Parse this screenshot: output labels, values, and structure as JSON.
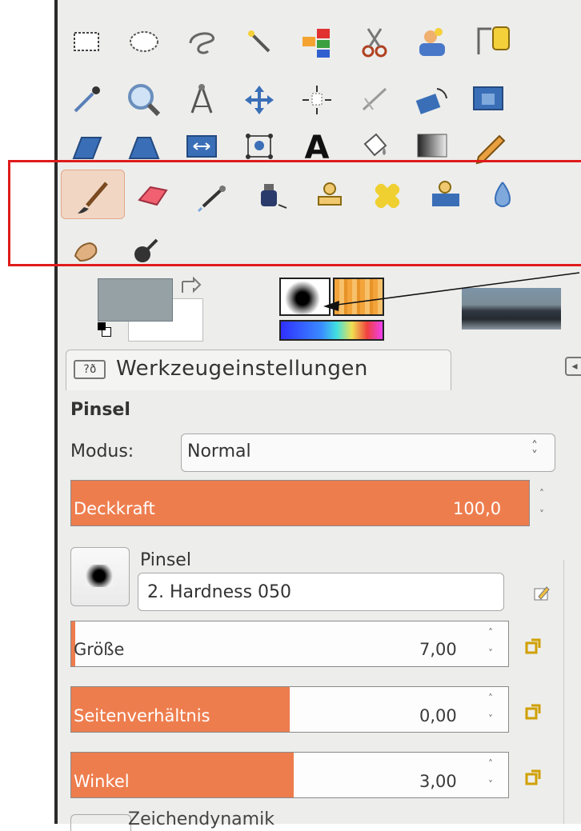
{
  "toolbox": {
    "icons": [
      "rect-select-icon",
      "ellipse-select-icon",
      "free-select-icon",
      "fuzzy-select-icon",
      "color-select-icon",
      "scissors-select-icon",
      "foreground-select-icon",
      "paths-tool-icon",
      "color-picker-icon",
      "zoom-icon",
      "measure-icon",
      "move-icon",
      "align-icon",
      "crop-icon",
      "rotate-icon",
      "scale-icon",
      "shear-icon",
      "perspective-icon",
      "flip-icon",
      "cage-transform-icon",
      "text-tool-icon",
      "bucket-fill-icon",
      "blend-icon",
      "pencil-icon",
      "paintbrush-icon",
      "eraser-icon",
      "airbrush-icon",
      "ink-icon",
      "clone-icon",
      "heal-icon",
      "perspective-clone-icon",
      "blur-sharpen-icon",
      "smudge-icon",
      "dodge-burn-icon"
    ],
    "active_tool": "paintbrush-icon",
    "highlight_color": "#e01b1b"
  },
  "colors": {
    "foreground": "#96a1a6",
    "background": "#ffffff",
    "accent": "#ee7d4e"
  },
  "tool_options": {
    "tab_icon_text": "?ð",
    "tab_label": "Werkzeugeinstellungen",
    "section_title": "Pinsel",
    "modus_label": "Modus:",
    "modus_value": "Normal",
    "opacity": {
      "label": "Deckkraft",
      "value": "100,0",
      "fill": 1.0
    },
    "brush_title": "Pinsel",
    "brush_value": "2. Hardness 050",
    "size": {
      "label": "Größe",
      "value": "7,00",
      "fill": 0.01
    },
    "aspect": {
      "label": "Seitenverhältnis",
      "value": "0,00",
      "fill": 0.5
    },
    "angle": {
      "label": "Winkel",
      "value": "3,00",
      "fill": 0.51
    },
    "next_section_partial": "Zeichendynamik"
  }
}
